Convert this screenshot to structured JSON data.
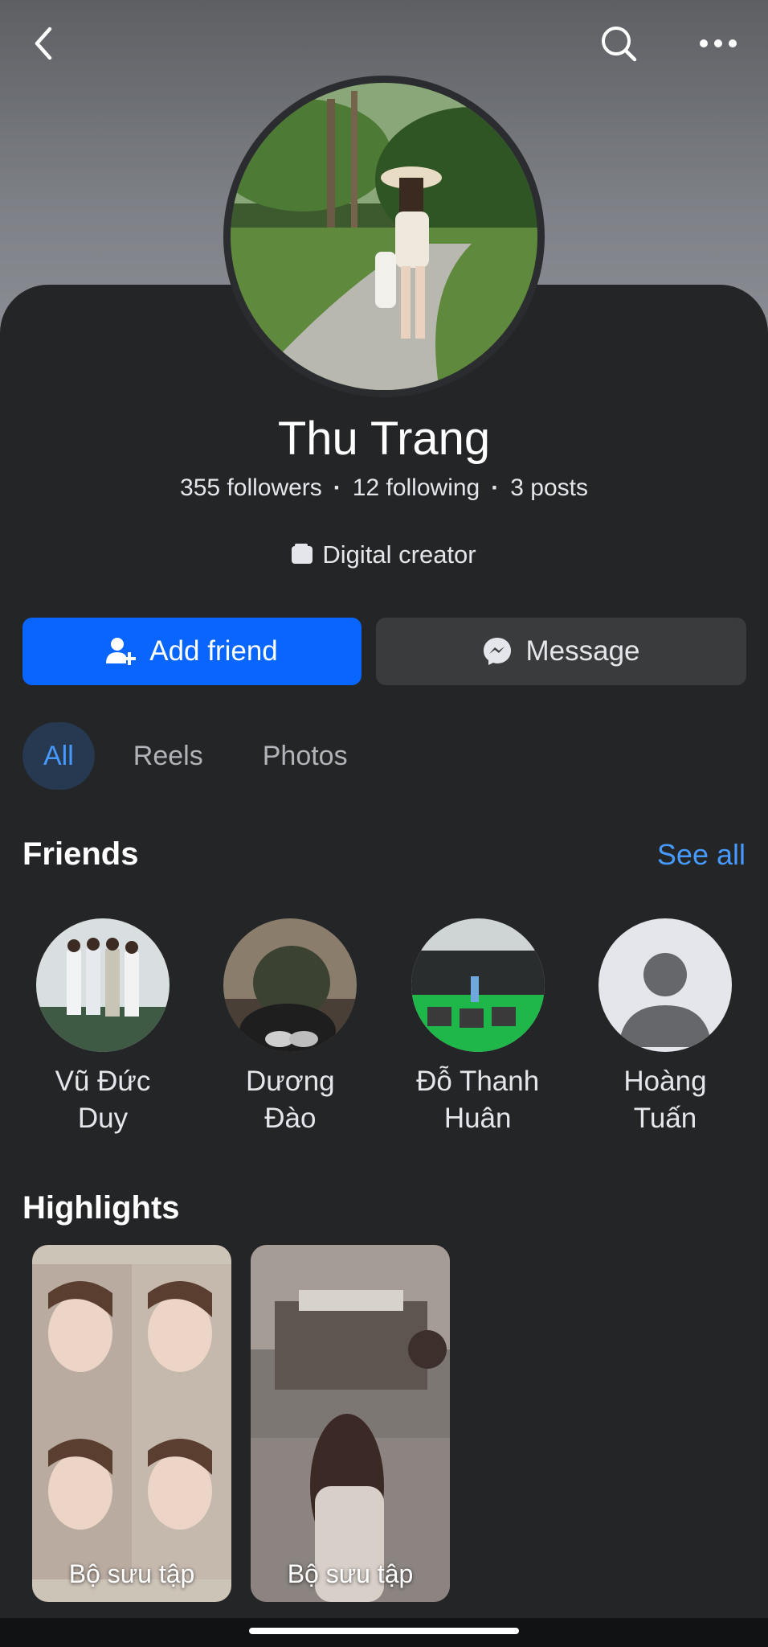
{
  "profile": {
    "name": "Thu Trang",
    "followers": "355 followers",
    "following": "12 following",
    "posts": "3 posts",
    "separator": "·",
    "category": "Digital creator"
  },
  "actions": {
    "add_friend": "Add friend",
    "message": "Message"
  },
  "filters": [
    "All",
    "Reels",
    "Photos"
  ],
  "friends_section": {
    "title": "Friends",
    "see_all": "See all",
    "items": [
      {
        "name": "Vũ Đức\nDuy"
      },
      {
        "name": "Dương\nĐào"
      },
      {
        "name": "Đỗ Thanh\nHuân"
      },
      {
        "name": "Hoàng\nTuấn"
      }
    ]
  },
  "highlights_section": {
    "title": "Highlights",
    "items": [
      {
        "label": "Bộ sưu tập"
      },
      {
        "label": "Bộ sưu tập"
      }
    ]
  },
  "colors": {
    "accent": "#0866ff",
    "link": "#4599ff",
    "background": "#242526"
  }
}
